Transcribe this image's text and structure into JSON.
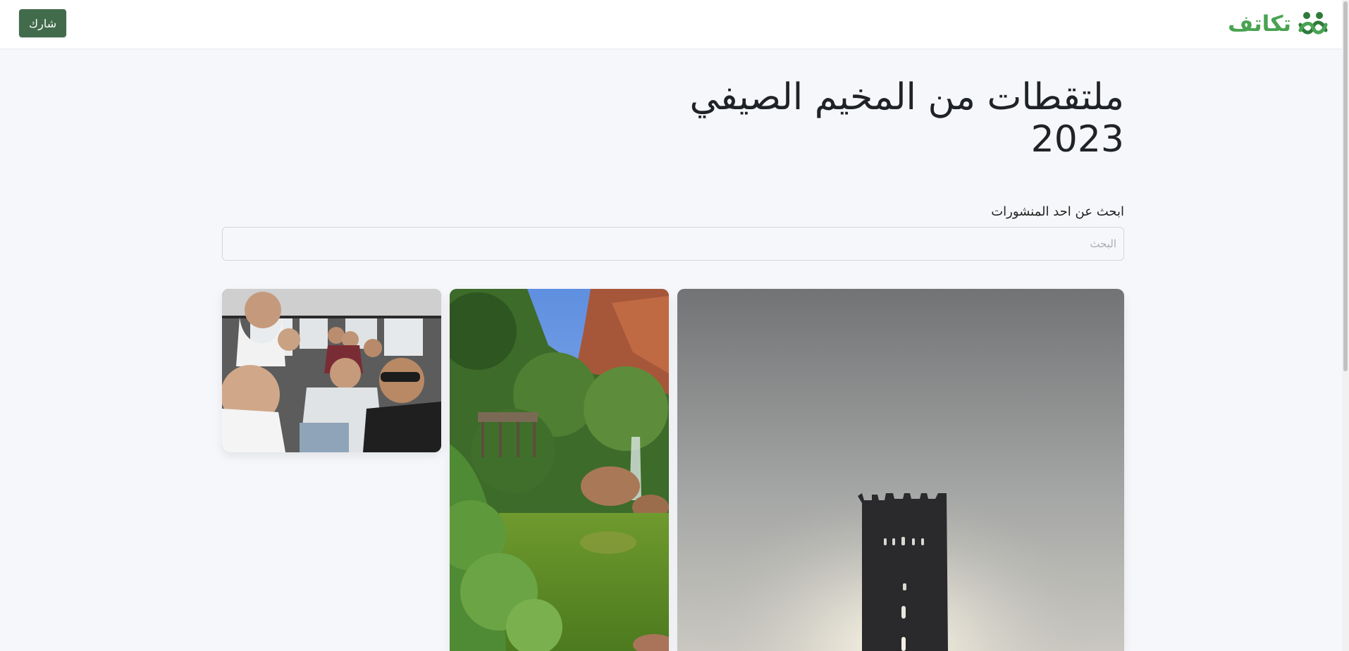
{
  "header": {
    "brand_name": "تكاتف",
    "logo_icon": "people-hug-logo-icon",
    "share_label": "شارك",
    "brand_color": "#49a352",
    "button_color": "#426b4c"
  },
  "main": {
    "title_line1": "ملتقطات من المخيم الصيفي",
    "title_line2": "2023",
    "search_label": "ابحث عن احد المنشورات",
    "search_placeholder": "البحث",
    "search_value": ""
  },
  "gallery": {
    "photos": [
      {
        "subject": "desert tower at sunset"
      },
      {
        "subject": "waterfall with green pond"
      },
      {
        "subject": "group selfie in bus"
      }
    ]
  }
}
